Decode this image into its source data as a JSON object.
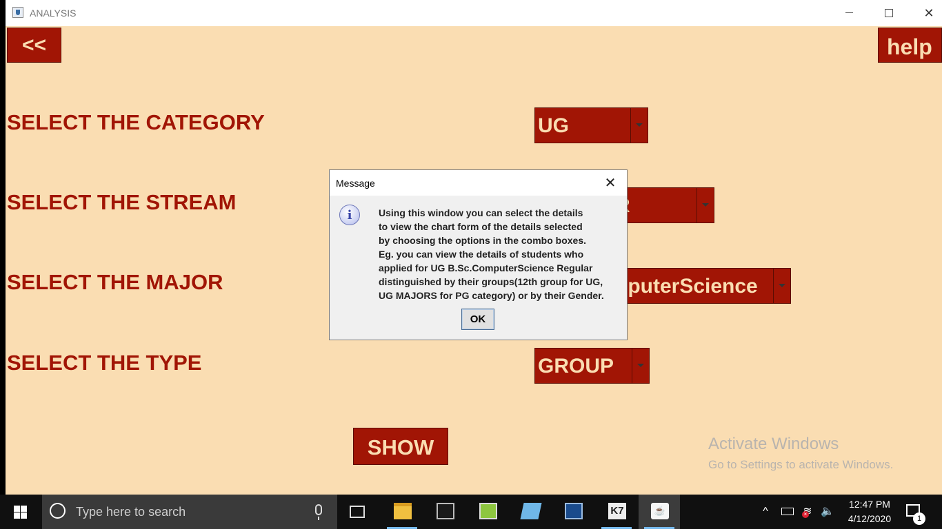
{
  "window": {
    "title": "ANALYSIS"
  },
  "buttons": {
    "back": "<<",
    "help": "help",
    "show": "SHOW"
  },
  "labels": {
    "category": "SELECT THE CATEGORY",
    "stream": "SELECT THE STREAM",
    "major": "SELECT THE MAJOR",
    "type": "SELECT THE TYPE"
  },
  "combos": {
    "category": "UG",
    "stream": "R",
    "major": "nputerScience",
    "type": "GROUP"
  },
  "watermark": {
    "line1": "Activate Windows",
    "line2": "Go to Settings to activate Windows."
  },
  "dialog": {
    "title": "Message",
    "icon": "info-icon",
    "lines": [
      "Using this window you can select the details",
      "to view the chart form of the details selected",
      "by choosing the options in the combo boxes.",
      "Eg. you can view the details of students who",
      "applied for UG B.Sc.ComputerScience Regular",
      "distinguished by their groups(12th group for UG,",
      "UG MAJORS for PG category) or by their Gender."
    ],
    "ok": "OK"
  },
  "taskbar": {
    "search_placeholder": "Type here to search",
    "time": "12:47 PM",
    "date": "4/12/2020",
    "notification_count": "1",
    "apps": [
      "task-view",
      "file-explorer",
      "command-prompt",
      "notepad",
      "azure-data-studio",
      "sql-plus",
      "k7-security",
      "java"
    ]
  },
  "colors": {
    "window_bg": "#FADDB2",
    "accent": "#A11505",
    "taskbar": "#101010"
  }
}
